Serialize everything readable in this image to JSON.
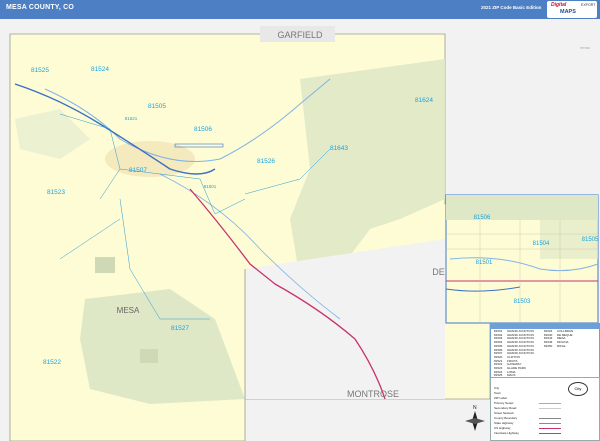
{
  "header": {
    "title": "MESA COUNTY, CO",
    "edition": "2021 ZIP Code Basic Edition",
    "logo_top": "Digital",
    "logo_main": "MAPS",
    "logo_side": "EXPORT"
  },
  "map": {
    "neighbors": {
      "north": "GARFIELD",
      "south": "MONTROSE",
      "east_partial": "DEL",
      "northeast_small": "PITKIN"
    },
    "zip_labels": [
      "81525",
      "81524",
      "81521",
      "81505",
      "81506",
      "81526",
      "81643",
      "81624",
      "81507",
      "81501",
      "81523",
      "81527",
      "81522"
    ],
    "place_labels": [
      "MESA"
    ],
    "colors": {
      "zip_label": "#1aa3e0",
      "land_fill": "#fdfcd5",
      "public_land": "#dfe8c6",
      "other_county": "#f0f0f0",
      "highway": "#c8326e",
      "border": "#888888"
    }
  },
  "inset": {
    "zip_labels": [
      "81506",
      "81504",
      "81501",
      "81503",
      "81505"
    ],
    "city_label": "DEL"
  },
  "legend": {
    "title": "ZIP Code Index"
  },
  "key": {
    "items": [
      "City",
      "Town",
      "ZIP Label",
      "Primary Sewer",
      "Secondary Road",
      "Street Network",
      "County Boundary",
      "State Highway",
      "US Highway",
      "Interstate Highway",
      "Rail Network"
    ]
  },
  "north_arrow": "N",
  "city_badge": "City"
}
